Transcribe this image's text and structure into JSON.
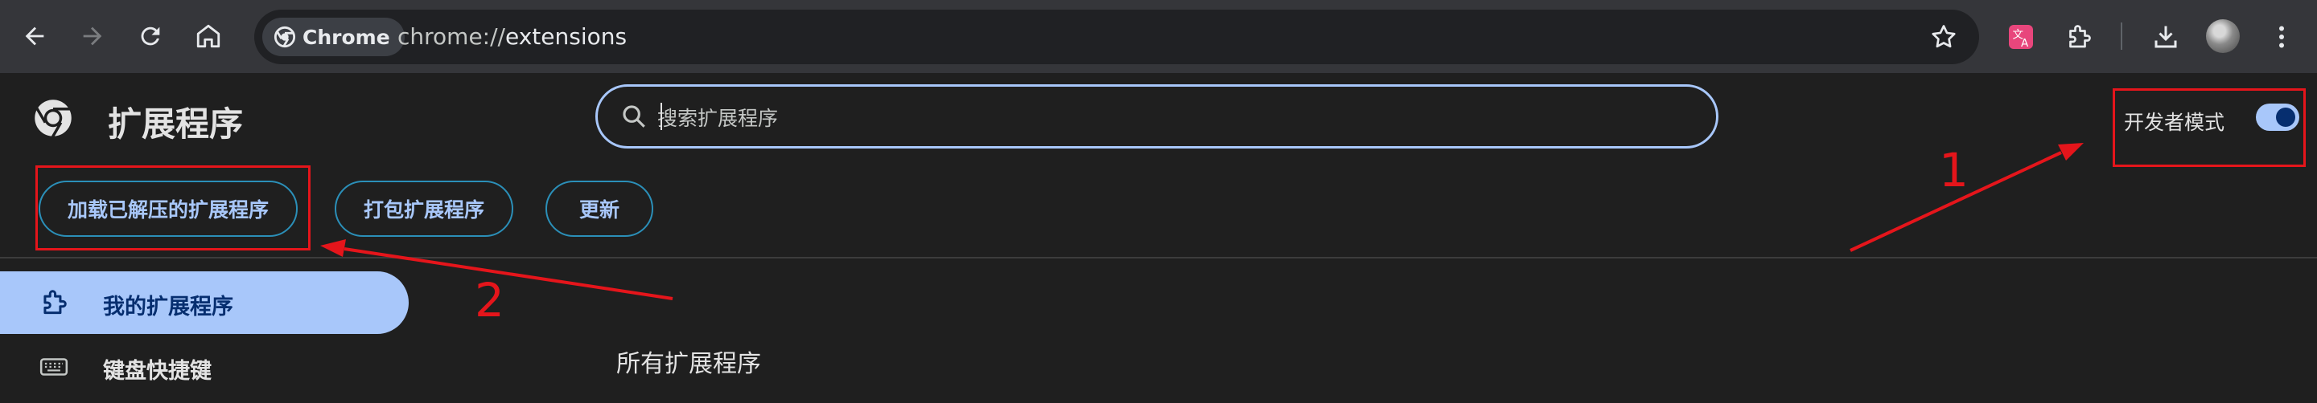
{
  "browser": {
    "chip_label": "Chrome",
    "url_scheme": "chrome://",
    "url_host": "extensions"
  },
  "header": {
    "title": "扩展程序",
    "search_placeholder": "搜索扩展程序",
    "dev_mode_label": "开发者模式",
    "dev_mode_on": true
  },
  "actions": {
    "load_unpacked": "加载已解压的扩展程序",
    "pack": "打包扩展程序",
    "update": "更新"
  },
  "sidebar": {
    "items": [
      {
        "label": "我的扩展程序",
        "icon": "puzzle-icon",
        "active": true
      },
      {
        "label": "键盘快捷键",
        "icon": "keyboard-icon",
        "active": false
      }
    ]
  },
  "main": {
    "section_title": "所有扩展程序"
  },
  "annotations": {
    "label_1": "1",
    "label_2": "2",
    "color": "#e5151b"
  },
  "colors": {
    "accent": "#a8c7fa",
    "accent_dark": "#062e6f",
    "toolbar": "#35363a",
    "page_bg": "#1f1f1f"
  }
}
